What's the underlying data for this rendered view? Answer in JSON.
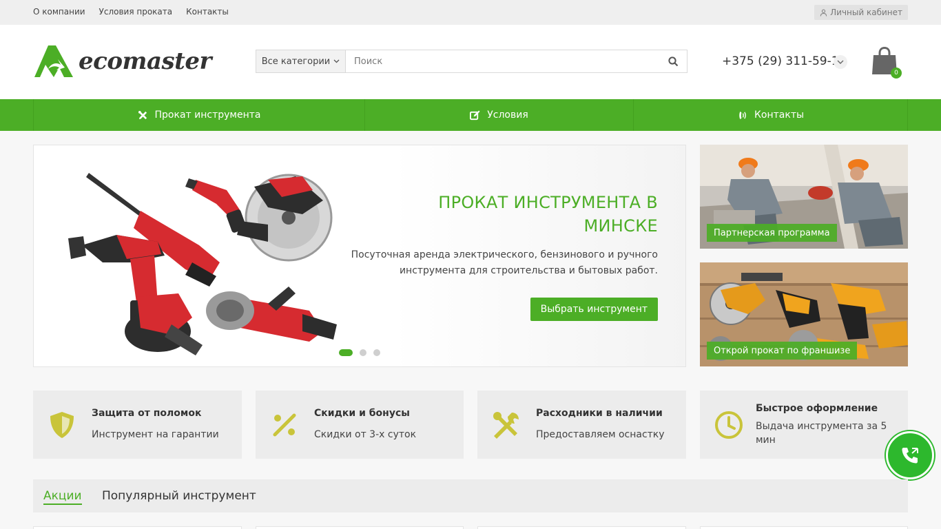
{
  "topbar": {
    "links": [
      "О компании",
      "Условия проката",
      "Контакты"
    ],
    "account_label": "Личный кабинет"
  },
  "header": {
    "logo_text": "ecomaster",
    "category_select": "Все категории",
    "search_placeholder": "Поиск",
    "phone": "+375 (29) 311-59-11",
    "cart_count": "0"
  },
  "nav": {
    "items": [
      {
        "label": "Прокат инструмента",
        "icon": "wrench-screwdriver-icon"
      },
      {
        "label": "Условия",
        "icon": "edit-icon"
      },
      {
        "label": "Контакты",
        "icon": "phone-volume-icon"
      }
    ]
  },
  "slider": {
    "title": "ПРОКАТ ИНСТРУМЕНТА В МИНСКЕ",
    "description": "Посуточная аренда электрического, бензинового и ручного инструмента для строительства и бытовых работ.",
    "button": "Выбрать инструмент",
    "slides_count": 3,
    "active_slide": 1
  },
  "banners": [
    {
      "label": "Партнерская программа"
    },
    {
      "label": "Открой прокат по франшизе"
    }
  ],
  "features": [
    {
      "title": "Защита от поломок",
      "text": "Инструмент на гарантии",
      "icon": "shield-icon"
    },
    {
      "title": "Скидки и бонусы",
      "text": "Скидки от 3-х суток",
      "icon": "percent-icon"
    },
    {
      "title": "Расходники в наличии",
      "text": "Предоставляем оснастку",
      "icon": "tools-icon"
    },
    {
      "title": "Быстрое оформление",
      "text": "Выдача инструмента за 5 мин",
      "icon": "clock-icon"
    }
  ],
  "tabs": {
    "items": [
      "Акции",
      "Популярный инструмент"
    ],
    "active": "Акции"
  },
  "colors": {
    "brand_green": "#4cae26",
    "icon_olive": "#c9c43a",
    "call_green": "#2db82d"
  }
}
